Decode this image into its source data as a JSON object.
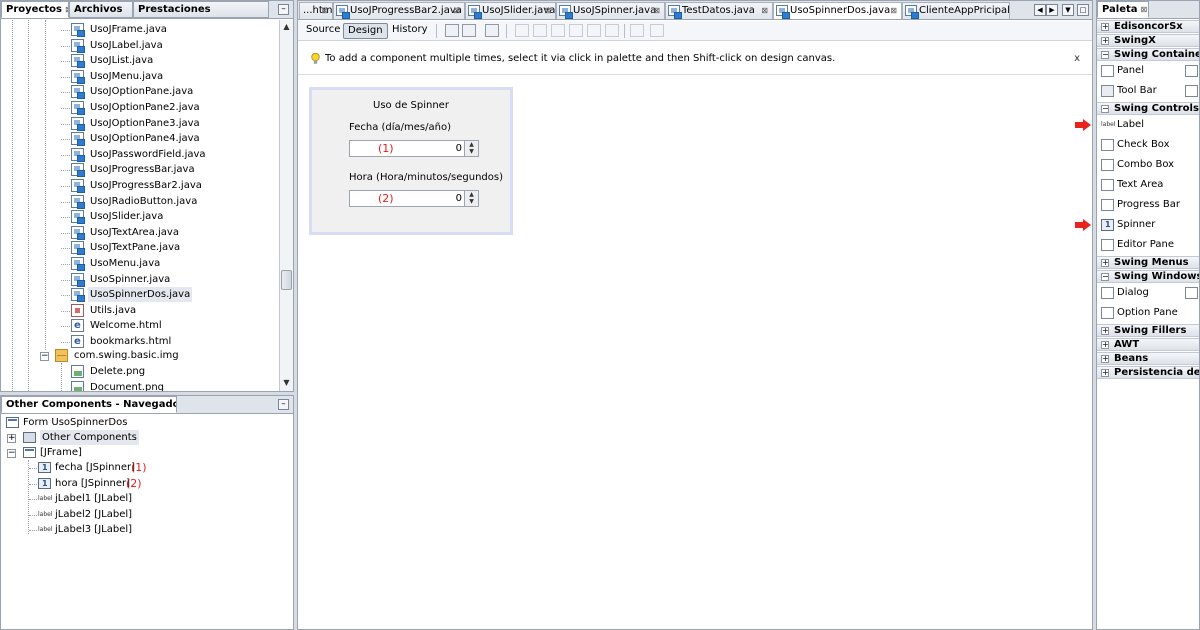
{
  "projects": {
    "tabs": [
      "Proyectos",
      "Archivos",
      "Prestaciones"
    ],
    "minimize": "–",
    "files": [
      {
        "name": "UsoJFrame.java",
        "type": "java"
      },
      {
        "name": "UsoJLabel.java",
        "type": "java"
      },
      {
        "name": "UsoJList.java",
        "type": "java"
      },
      {
        "name": "UsoJMenu.java",
        "type": "java"
      },
      {
        "name": "UsoJOptionPane.java",
        "type": "java"
      },
      {
        "name": "UsoJOptionPane2.java",
        "type": "java"
      },
      {
        "name": "UsoJOptionPane3.java",
        "type": "java"
      },
      {
        "name": "UsoJOptionPane4.java",
        "type": "java"
      },
      {
        "name": "UsoJPasswordField.java",
        "type": "java"
      },
      {
        "name": "UsoJProgressBar.java",
        "type": "java"
      },
      {
        "name": "UsoJProgressBar2.java",
        "type": "java"
      },
      {
        "name": "UsoJRadioButton.java",
        "type": "java"
      },
      {
        "name": "UsoJSlider.java",
        "type": "java"
      },
      {
        "name": "UsoJTextArea.java",
        "type": "java"
      },
      {
        "name": "UsoJTextPane.java",
        "type": "java"
      },
      {
        "name": "UsoMenu.java",
        "type": "java"
      },
      {
        "name": "UsoSpinner.java",
        "type": "java"
      },
      {
        "name": "UsoSpinnerDos.java",
        "type": "java",
        "selected": true
      },
      {
        "name": "Utils.java",
        "type": "utils"
      },
      {
        "name": "Welcome.html",
        "type": "html"
      },
      {
        "name": "bookmarks.html",
        "type": "html"
      }
    ],
    "package": "com.swing.basic.img",
    "package_files": [
      "Delete.png",
      "Document.png"
    ]
  },
  "navigator": {
    "title": "Other Components - Navegador",
    "minimize": "–",
    "form": "Form UsoSpinnerDos",
    "other": "Other Components",
    "jframe": "[JFrame]",
    "children": [
      {
        "label": "fecha [JSpinner]",
        "type": "spinner",
        "annotation": "(1)"
      },
      {
        "label": "hora [JSpinner]",
        "type": "spinner",
        "annotation": "(2)"
      },
      {
        "label": "jLabel1 [JLabel]",
        "type": "label",
        "annotation": ""
      },
      {
        "label": "jLabel2 [JLabel]",
        "type": "label",
        "annotation": ""
      },
      {
        "label": "jLabel3 [JLabel]",
        "type": "label",
        "annotation": ""
      }
    ]
  },
  "editor": {
    "tabs": [
      {
        "label": "...htm",
        "active": false
      },
      {
        "label": "UsoJProgressBar2.java",
        "active": false
      },
      {
        "label": "UsoJSlider.java",
        "active": false
      },
      {
        "label": "UsoJSpinner.java",
        "active": false
      },
      {
        "label": "TestDatos.java",
        "active": false
      },
      {
        "label": "UsoSpinnerDos.java",
        "active": true
      },
      {
        "label": "ClienteAppPricipal....",
        "active": false
      }
    ],
    "views": {
      "source": "Source",
      "design": "Design",
      "history": "History"
    },
    "hint": "To add a component multiple times, select it via click in palette and then Shift-click on design canvas.",
    "hint_close": "x",
    "form": {
      "title": "Uso de Spinner",
      "fecha_label": "Fecha (día/mes/año)",
      "fecha_annotation": "(1)",
      "fecha_value": "0",
      "hora_label": "Hora (Hora/minutos/segundos)",
      "hora_annotation": "(2)",
      "hora_value": "0"
    }
  },
  "palette": {
    "title": "Paleta",
    "categories": {
      "edison": "EdisoncorSx",
      "swingx": "SwingX",
      "containers": "Swing Containers",
      "controls": "Swing Controls",
      "menus": "Swing Menus",
      "windows": "Swing Windows",
      "fillers": "Swing Fillers",
      "awt": "AWT",
      "beans": "Beans",
      "persistencia": "Persistencia de Ja"
    },
    "containers_items": [
      "Panel",
      "Tool Bar"
    ],
    "controls_items": [
      "Label",
      "Check Box",
      "Combo Box",
      "Text Area",
      "Progress Bar",
      "Spinner",
      "Editor Pane"
    ],
    "windows_items": [
      "Dialog",
      "Option Pane"
    ],
    "colors": {
      "arrow": "#e8231e"
    }
  }
}
